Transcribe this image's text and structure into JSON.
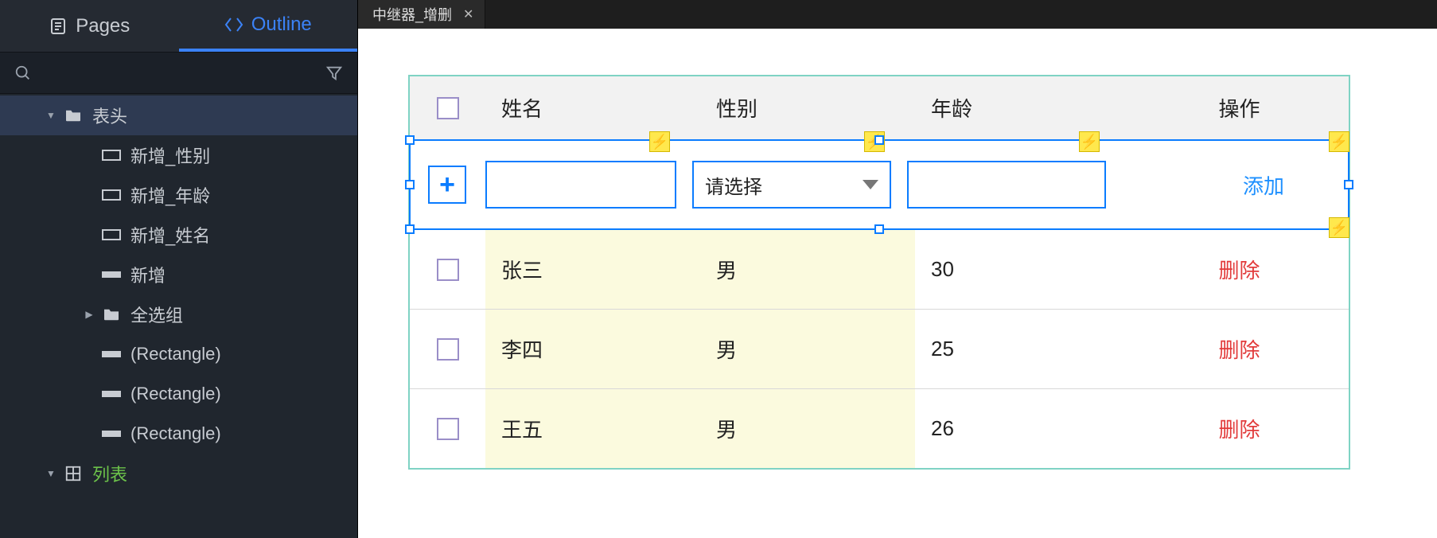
{
  "tab": {
    "title": "中继器_增删"
  },
  "panel": {
    "tabs": {
      "pages": "Pages",
      "outline": "Outline"
    }
  },
  "tree": {
    "n0": "表头",
    "n1": "新增_性别",
    "n2": "新增_年龄",
    "n3": "新增_姓名",
    "n4": "新增",
    "n5": "全选组",
    "n6": "(Rectangle)",
    "n7": "(Rectangle)",
    "n8": "(Rectangle)",
    "n9": "列表"
  },
  "table": {
    "headers": {
      "name": "姓名",
      "sex": "性别",
      "age": "年龄",
      "op": "操作"
    },
    "add": {
      "select_placeholder": "请选择",
      "add_label": "添加",
      "plus": "+"
    },
    "rows": [
      {
        "name": "张三",
        "sex": "男",
        "age": "30",
        "op": "删除"
      },
      {
        "name": "李四",
        "sex": "男",
        "age": "25",
        "op": "删除"
      },
      {
        "name": "王五",
        "sex": "男",
        "age": "26",
        "op": "删除"
      }
    ]
  }
}
